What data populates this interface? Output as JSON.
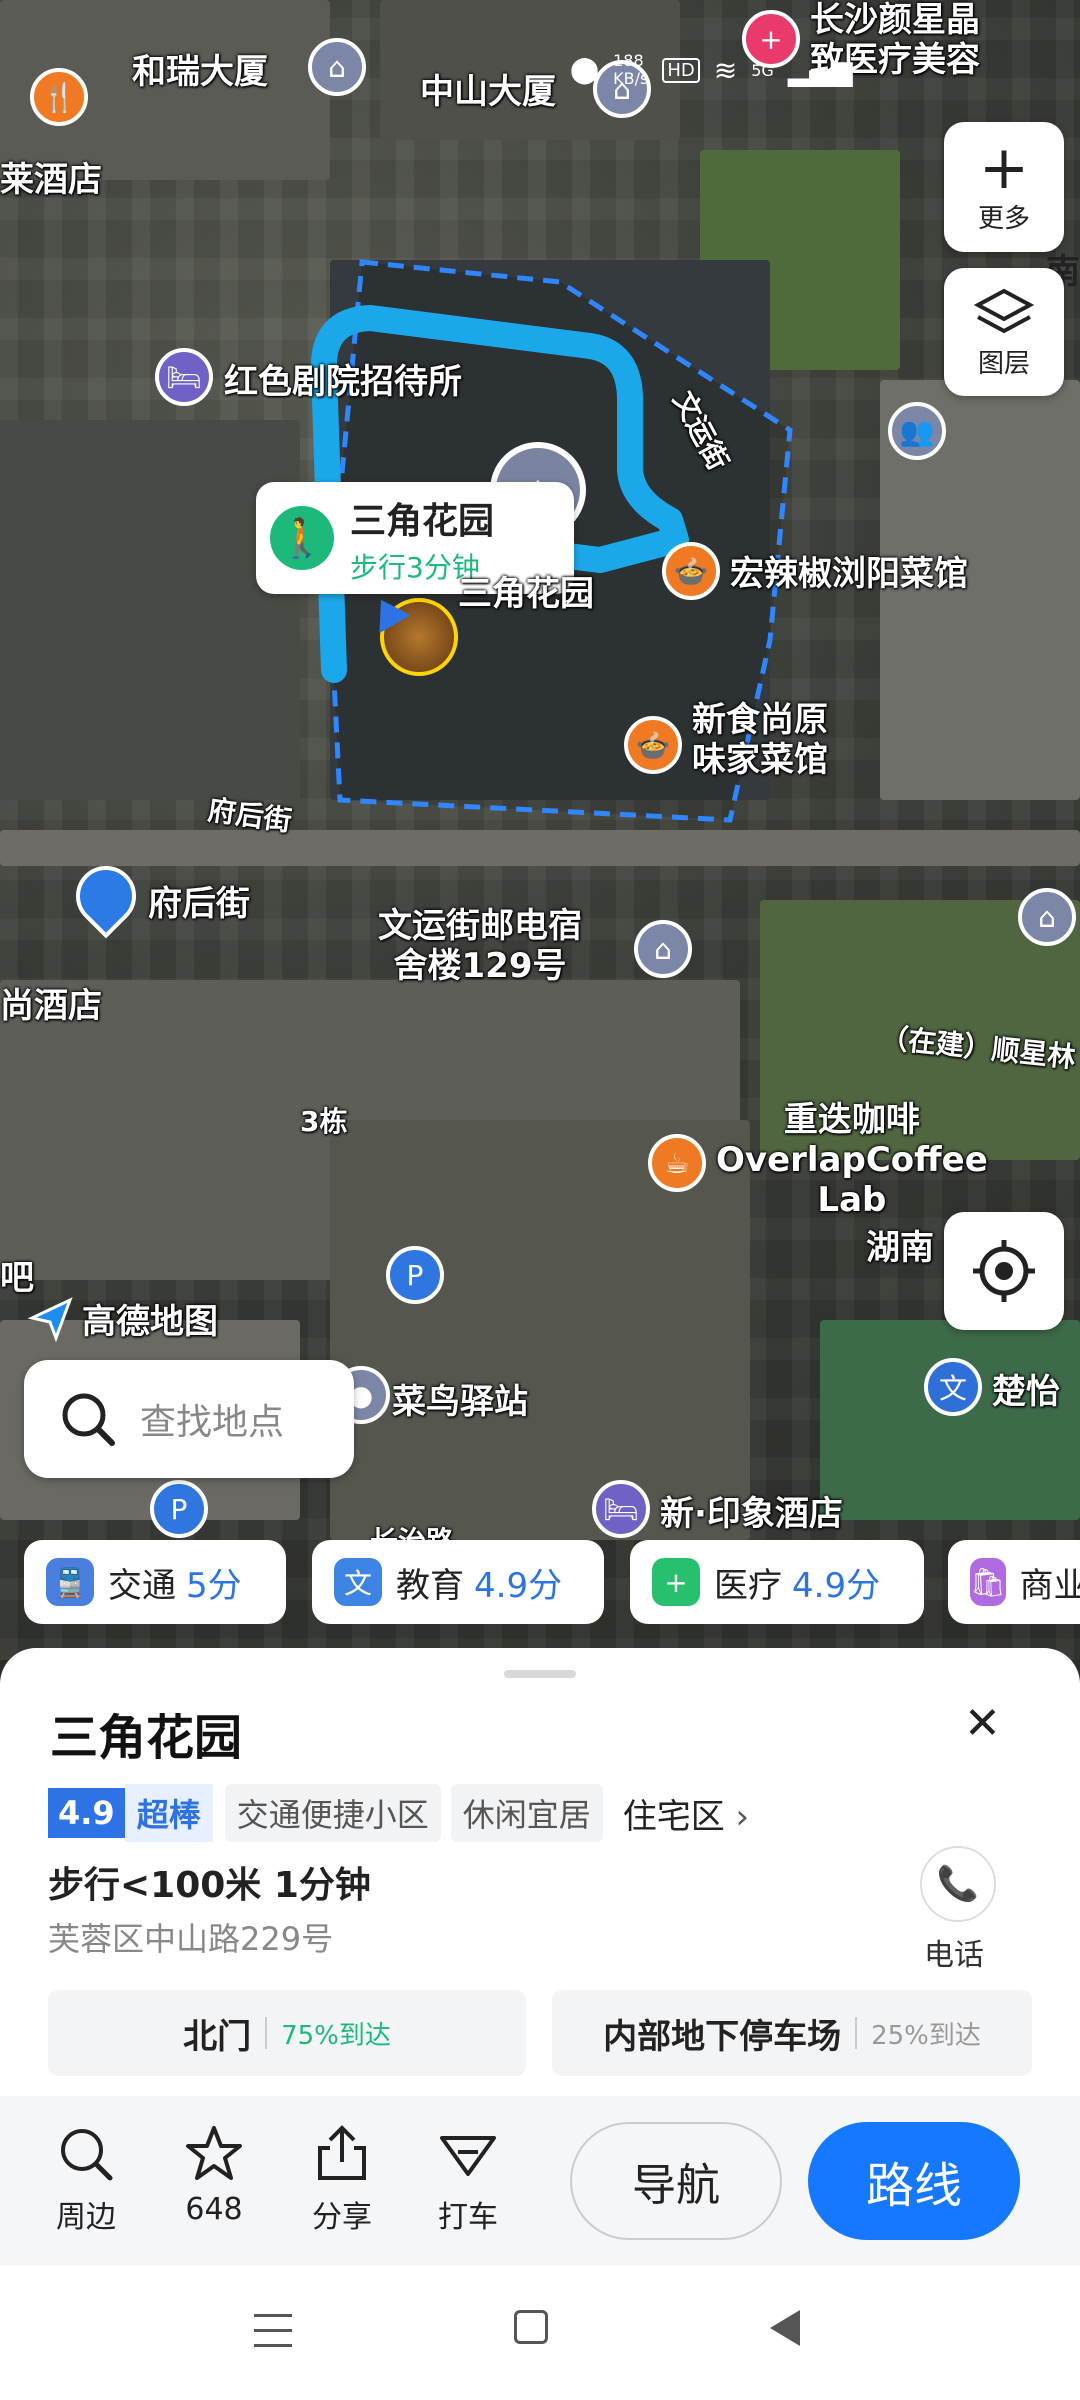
{
  "status_bar": {
    "net_speed": "188\nKB/s",
    "hd": "HD",
    "signal": "5G"
  },
  "map": {
    "labels": {
      "heruidasha": "和瑞大厦",
      "zhongshandasha": "中山大厦",
      "changsha_yanxing": "长沙颜星晶\n致医疗美容",
      "laijiudian": "莱酒店",
      "hongse": "红色剧院招待所",
      "sanjiao": "三角花园",
      "hongla": "宏辣椒浏阳菜馆",
      "xinshi": "新食尚原\n味家菜馆",
      "wenyunjie_road": "文运街",
      "fuhoujie_road": "府后街",
      "fuhoujie": "府后街",
      "youdian": "文运街邮电宿\n舍楼129号",
      "shangjiudian": "尚酒店",
      "zaijian": "（在建）顺星林",
      "san_dong": "3栋",
      "chongdie": "重迭咖啡\nOverlapCoffee\nLab",
      "hunan": "湖南",
      "ba": "吧",
      "cainiao": "菜鸟驿站",
      "chuyi": "楚怡",
      "xinyinxiang": "新·印象酒店",
      "changzhilu": "长治路",
      "nan": "南",
      "logo": "高德地图"
    },
    "callout": {
      "title": "三角花园",
      "walk": "步行3分钟"
    },
    "controls": {
      "more": "更多",
      "layers": "图层"
    },
    "search_placeholder": "查找地点",
    "chips": [
      {
        "label": "交通",
        "score": "5分",
        "color": "#4a7fe0"
      },
      {
        "label": "教育",
        "score": "4.9分",
        "color": "#3d84e3"
      },
      {
        "label": "医疗",
        "score": "4.9分",
        "color": "#26c06f"
      },
      {
        "label": "商业",
        "score": "",
        "color": "#b06be0"
      }
    ]
  },
  "sheet": {
    "title": "三角花园",
    "rating": "4.9",
    "rating_word": "超棒",
    "tags": [
      "交通便捷小区",
      "休闲宜居"
    ],
    "category": "住宅区",
    "distance": "步行<100米 1分钟",
    "address": "芙蓉区中山路229号",
    "phone_label": "电话",
    "entries": [
      {
        "name": "北门",
        "pct": "75%到达"
      },
      {
        "name": "内部地下停车场",
        "pct": "25%到达"
      }
    ]
  },
  "actions": {
    "nearby": "周边",
    "favorites": "648",
    "share": "分享",
    "taxi": "打车",
    "navigate": "导航",
    "route": "路线"
  },
  "colors": {
    "accent": "#1677ff",
    "route": "#1ba8ea",
    "green": "#1db97a"
  }
}
